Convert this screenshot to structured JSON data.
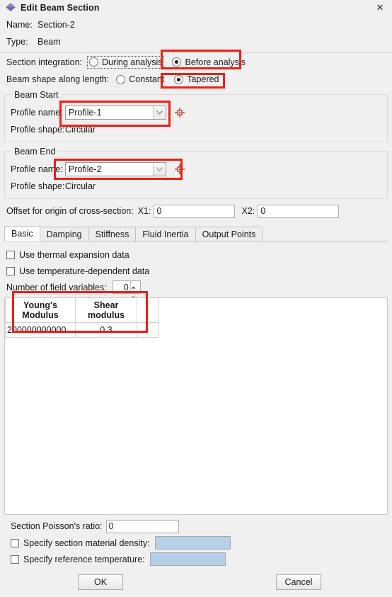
{
  "window": {
    "title": "Edit Beam Section",
    "icon": "abaqus-diamond-icon",
    "close_label": "✕"
  },
  "header": {
    "name_label": "Name:",
    "name_value": "Section-2",
    "type_label": "Type:",
    "type_value": "Beam"
  },
  "section_integration": {
    "label": "Section integration:",
    "options": [
      {
        "label": "During analysis",
        "selected": false
      },
      {
        "label": "Before analysis",
        "selected": true
      }
    ]
  },
  "beam_shape": {
    "label": "Beam shape along length:",
    "options": [
      {
        "label": "Constant",
        "selected": false
      },
      {
        "label": "Tapered",
        "selected": true
      }
    ]
  },
  "beam_start": {
    "group_title": "Beam Start",
    "profile_name_label": "Profile name:",
    "profile_name_value": "Profile-1",
    "profile_shape_label": "Profile shape:",
    "profile_shape_value": "Circular",
    "edit_icon": "crosshair-icon"
  },
  "beam_end": {
    "group_title": "Beam End",
    "profile_name_label": "Profile name:",
    "profile_name_value": "Profile-2",
    "profile_shape_label": "Profile shape:",
    "profile_shape_value": "Circular",
    "edit_icon": "crosshair-icon"
  },
  "offset": {
    "label": "Offset for origin of cross-section:",
    "x1_label": "X1:",
    "x1_value": "0",
    "x2_label": "X2:",
    "x2_value": "0"
  },
  "tabs": [
    {
      "label": "Basic",
      "active": true
    },
    {
      "label": "Damping",
      "active": false
    },
    {
      "label": "Stiffness",
      "active": false
    },
    {
      "label": "Fluid Inertia",
      "active": false
    },
    {
      "label": "Output Points",
      "active": false
    }
  ],
  "basic": {
    "thermal_expansion_label": "Use thermal expansion data",
    "thermal_expansion_checked": false,
    "temperature_dependent_label": "Use temperature-dependent data",
    "temperature_dependent_checked": false,
    "field_variables_label": "Number of field variables:",
    "field_variables_value": "0"
  },
  "table": {
    "columns": [
      "Young's\nModulus",
      "Shear\nmodulus",
      ""
    ],
    "rows": [
      [
        "200000000000",
        "0.3",
        ""
      ]
    ]
  },
  "footer": {
    "poisson_label": "Section Poisson's ratio:",
    "poisson_value": "0",
    "density_label": "Specify section material density:",
    "density_checked": false,
    "density_value": "",
    "reference_temp_label": "Specify reference temperature:",
    "reference_temp_checked": false,
    "reference_temp_value": ""
  },
  "buttons": {
    "ok": "OK",
    "cancel": "Cancel"
  },
  "annotations": {
    "accent_color": "#f01e14",
    "highlight_count": 5
  }
}
